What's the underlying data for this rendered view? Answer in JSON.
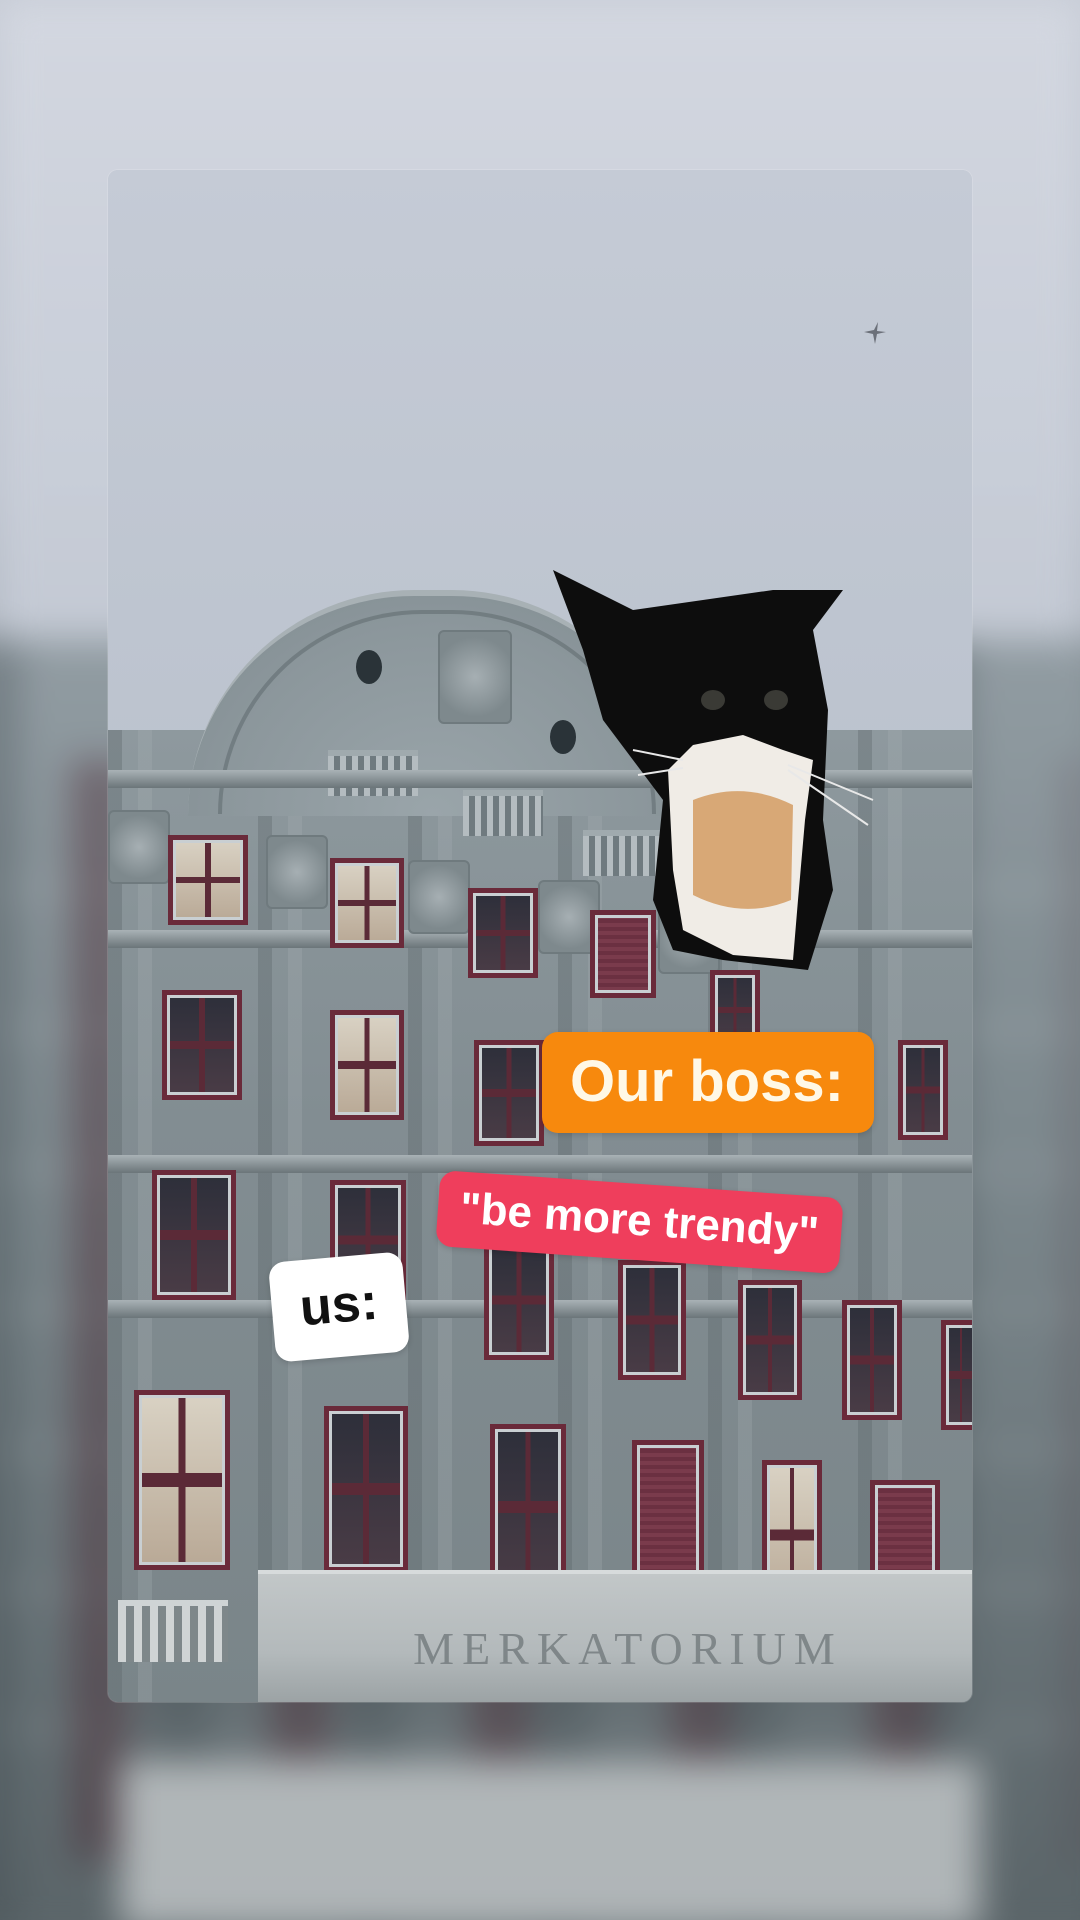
{
  "captions": {
    "boss": "Our boss:",
    "request": "\"be more trendy\"",
    "us": "us:"
  },
  "building_sign": "MERKATORIUM",
  "colors": {
    "boss_caption_bg": "#f7890d",
    "request_caption_bg": "#ef3e5c",
    "us_caption_bg": "#ffffff"
  },
  "icons": {
    "bird": "bird-icon",
    "cat": "cat-icon"
  }
}
